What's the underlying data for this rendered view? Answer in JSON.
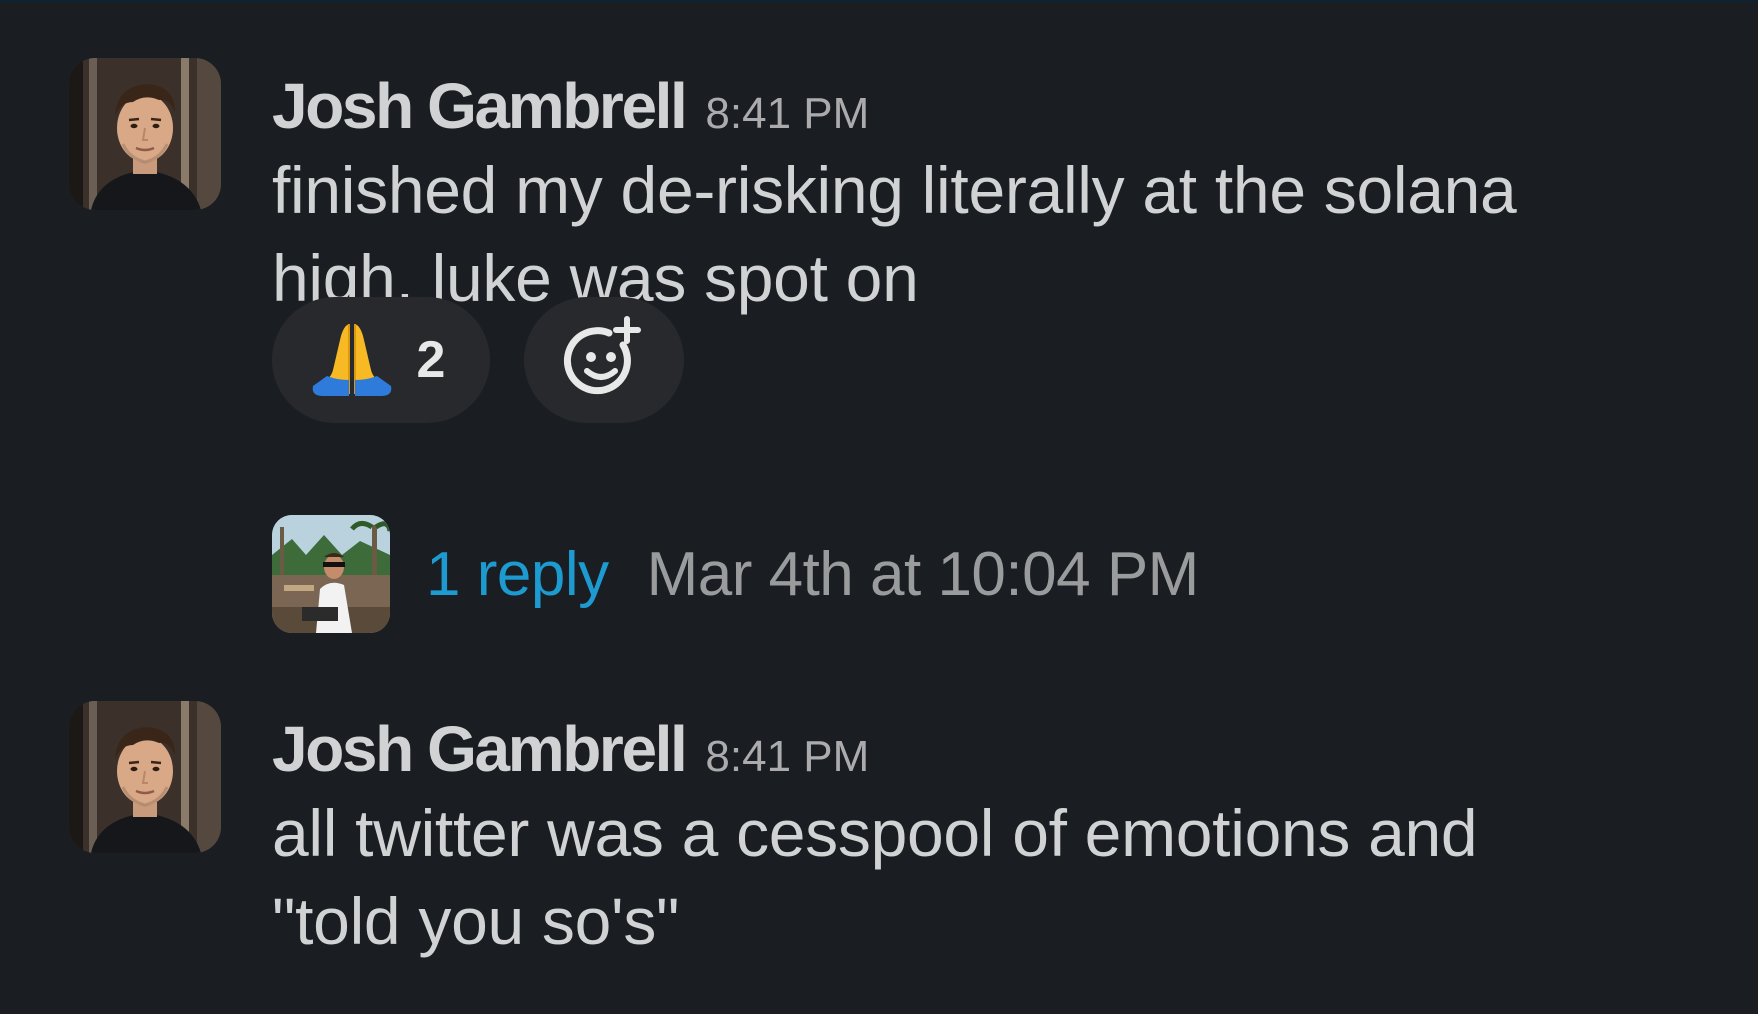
{
  "colors": {
    "background": "#1a1d21",
    "text": "#d1d2d3",
    "timestamp": "#ababad",
    "link": "#1d9bd1",
    "reaction_bg": "#27292d"
  },
  "messages": [
    {
      "author": "Josh Gambrell",
      "time": "8:41 PM",
      "lines": [
        "finished my de-risking literally at the solana",
        "high, luke was spot on"
      ],
      "reactions": [
        {
          "emoji": "folded-hands",
          "count": "2"
        }
      ],
      "add_reaction_icon": "add-emoji-icon",
      "thread": {
        "reply_text": "1 reply",
        "last_reply": "Mar 4th at 10:04 PM"
      }
    },
    {
      "author": "Josh Gambrell",
      "time": "8:41 PM",
      "lines": [
        "all twitter was a cesspool of emotions and",
        "\"told you so's\""
      ]
    }
  ]
}
